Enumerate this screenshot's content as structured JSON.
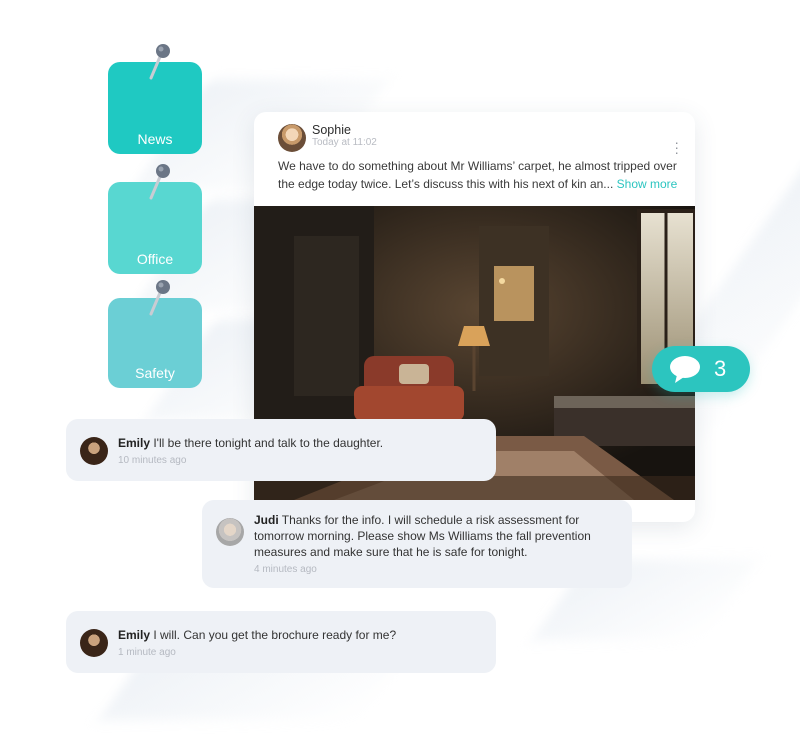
{
  "tags": [
    {
      "label": "News",
      "color": "#1fc9c2"
    },
    {
      "label": "Office",
      "color": "#58d7d1"
    },
    {
      "label": "Safety",
      "color": "#6bcfd5"
    }
  ],
  "post": {
    "author": "Sophie",
    "time": "Today at 11:02",
    "text": "We have to do something about Mr Williams’ carpet, he almost tripped over the edge today twice. Let’s discuss this with his next of kin an...",
    "show_more": "Show more"
  },
  "comment_count": "3",
  "comments": [
    {
      "author": "Emily",
      "text": " I'll be there tonight and talk to the daughter.",
      "time": "10 minutes ago"
    },
    {
      "author": "Judi",
      "text": " Thanks for the info. I will schedule a risk assessment for tomorrow morning. Please show Ms Williams the fall prevention measures and make sure that he is safe for tonight.",
      "time": "4 minutes ago"
    },
    {
      "author": "Emily",
      "text": " I will. Can you get the brochure ready for me?",
      "time": "1 minute ago"
    }
  ],
  "colors": {
    "accent": "#2cc5bf",
    "comment_bg": "#eef1f6"
  },
  "icons": [
    "push-pin-icon",
    "chat-bubble-icon",
    "kebab-menu-icon"
  ]
}
